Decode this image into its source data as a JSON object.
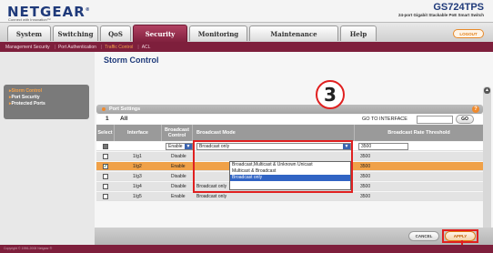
{
  "brand": {
    "logo": "NETGEAR",
    "logo_mark": "®",
    "tagline": "Connect with Innovation™",
    "model": "GS724TPS",
    "model_desc": "24-port Gigabit Stackable PoE Smart Switch"
  },
  "tabs": [
    {
      "label": "System",
      "active": false
    },
    {
      "label": "Switching",
      "active": false
    },
    {
      "label": "QoS",
      "active": false
    },
    {
      "label": "Security",
      "active": true
    },
    {
      "label": "Monitoring",
      "active": false
    },
    {
      "label": "Maintenance",
      "active": false
    },
    {
      "label": "Help",
      "active": false
    }
  ],
  "logout_label": "LOGOUT",
  "subnav": {
    "items": [
      "Management Security",
      "Port Authentication",
      "Traffic Control",
      "ACL"
    ],
    "current": "Traffic Control"
  },
  "sidebar": {
    "items": [
      {
        "label": "Storm Control",
        "active": true
      },
      {
        "label": "Port Security",
        "active": false
      },
      {
        "label": "Protected Ports",
        "active": false
      }
    ]
  },
  "main": {
    "title": "Storm Control",
    "section_title": "Port Settings",
    "count_one": "1",
    "count_all": "All",
    "goto_label": "GO TO INTERFACE",
    "goto_value": "",
    "go_label": "GO"
  },
  "table": {
    "headers": [
      "Select",
      "Interface",
      "Broadcast Control",
      "Broadcast Mode",
      "Broadcast Rate Threshold"
    ],
    "edit_row": {
      "control": "Enable",
      "mode": "Broadcast only",
      "threshold": "3500"
    },
    "rows": [
      {
        "interface": "1/g1",
        "control": "Disable",
        "mode": "",
        "threshold": "3500",
        "checked": false,
        "highlight": false
      },
      {
        "interface": "1/g2",
        "control": "Enable",
        "mode": "",
        "threshold": "3500",
        "checked": true,
        "highlight": true
      },
      {
        "interface": "1/g3",
        "control": "Disable",
        "mode": "",
        "threshold": "3500",
        "checked": false,
        "highlight": false
      },
      {
        "interface": "1/g4",
        "control": "Disable",
        "mode": "Broadcast only",
        "threshold": "3500",
        "checked": false,
        "highlight": false
      },
      {
        "interface": "1/g5",
        "control": "Enable",
        "mode": "Broadcast only",
        "threshold": "3500",
        "checked": false,
        "highlight": false
      }
    ]
  },
  "dropdown_options": [
    {
      "label": "Broadcast,Multicast & Unknown Unicast",
      "selected": false
    },
    {
      "label": "Multicast & Broadcast",
      "selected": false
    },
    {
      "label": "Broadcast only",
      "selected": true
    }
  ],
  "callout_number": "3",
  "buttons": {
    "cancel": "CANCEL",
    "apply": "APPLY"
  },
  "copyright": "Copyright © 1996-2008 Netgear ®",
  "colors": {
    "brand_blue": "#1f3a7a",
    "active_tab": "#7e1f3c",
    "accent_orange": "#f08a2c",
    "annotation_red": "#e02020"
  }
}
